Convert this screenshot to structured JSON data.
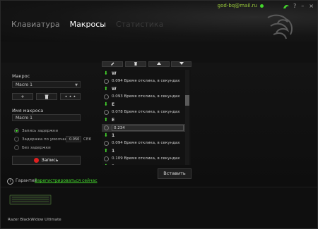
{
  "header": {
    "email": "god-bq@mail.ru",
    "tabs": [
      {
        "label": "Клавиатура",
        "state": "inactive"
      },
      {
        "label": "Макросы",
        "state": "active"
      },
      {
        "label": "Статистика",
        "state": "faded"
      }
    ],
    "window_buttons": [
      "?",
      "–",
      "×"
    ]
  },
  "left_panel": {
    "macro_label": "Макрос",
    "macro_select": "Macro 1",
    "add_label": "+",
    "delete_label": "🗑",
    "more_label": "• • •",
    "name_label": "Имя макроса",
    "name_value": "Macro 1",
    "options": [
      {
        "label": "Запись задержки",
        "selected": true
      },
      {
        "label": "Задержка по умолчанию",
        "selected": false
      },
      {
        "label": "Без задержки",
        "selected": false
      }
    ],
    "default_delay_value": "0.050",
    "default_delay_unit": "СЕК",
    "record_label": "Запись"
  },
  "toolbar": {
    "edit_icon": "pencil-icon",
    "delete_icon": "trash-icon",
    "up_icon": "move-up-icon",
    "down_icon": "move-down-icon"
  },
  "events": [
    {
      "type": "key",
      "text": "W"
    },
    {
      "type": "delay",
      "text": "0.094 Время отклика, в секундах"
    },
    {
      "type": "key",
      "text": "W"
    },
    {
      "type": "delay",
      "text": "0.093 Время отклика, в секундах"
    },
    {
      "type": "key",
      "text": "E"
    },
    {
      "type": "delay",
      "text": "0.078 Время отклика, в секундах"
    },
    {
      "type": "key",
      "text": "E"
    },
    {
      "type": "edit",
      "text": "0.234"
    },
    {
      "type": "key",
      "text": "1"
    },
    {
      "type": "delay",
      "text": "0.094 Время отклика, в секундах"
    },
    {
      "type": "key",
      "text": "1"
    },
    {
      "type": "delay",
      "text": "0.109 Время отклика, в секундах"
    },
    {
      "type": "key",
      "text": "2"
    }
  ],
  "insert_label": "Вставить",
  "warranty_label": "Гарантия",
  "register_label": "Зарегистрироваться сейчас",
  "device_name": "Razer BlackWidow Ultimate",
  "colors": {
    "accent": "#44d62c",
    "record": "#e02020"
  }
}
